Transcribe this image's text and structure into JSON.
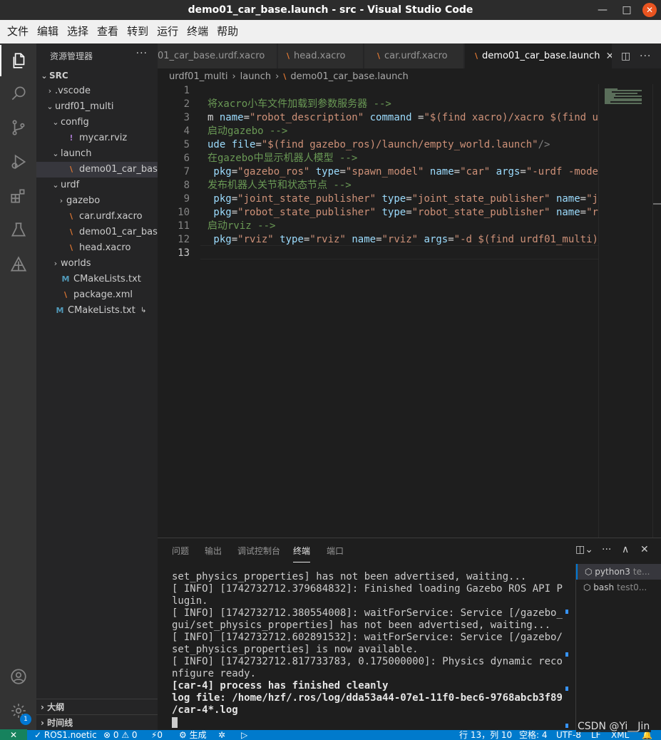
{
  "window": {
    "title": "demo01_car_base.launch - src - Visual Studio Code",
    "minimize_glyph": "—",
    "maximize_glyph": "□",
    "close_glyph": "✕"
  },
  "menu": [
    "文件",
    "编辑",
    "选择",
    "查看",
    "转到",
    "运行",
    "终端",
    "帮助"
  ],
  "activity_bar": {
    "icons": [
      "files-icon",
      "search-icon",
      "source-control-icon",
      "run-debug-icon",
      "extensions-icon",
      "testing-icon",
      "ros-icon"
    ],
    "bottom_icons": [
      "account-icon",
      "settings-gear-icon"
    ],
    "settings_badge": "1"
  },
  "sidebar": {
    "title": "资源管理器",
    "more": "···",
    "root": "SRC",
    "tree": [
      {
        "label": ".vscode",
        "indent": 1,
        "chevron": "›",
        "icon": ""
      },
      {
        "label": "urdf01_multi",
        "indent": 1,
        "chevron": "⌄",
        "icon": ""
      },
      {
        "label": "config",
        "indent": 2,
        "chevron": "⌄",
        "icon": ""
      },
      {
        "label": "mycar.rviz",
        "indent": 3,
        "chevron": "",
        "icon": "!"
      },
      {
        "label": "launch",
        "indent": 2,
        "chevron": "⌄",
        "icon": ""
      },
      {
        "label": "demo01_car_bas...",
        "indent": 3,
        "chevron": "",
        "icon": "rss",
        "selected": true
      },
      {
        "label": "urdf",
        "indent": 2,
        "chevron": "⌄",
        "icon": ""
      },
      {
        "label": "gazebo",
        "indent": 3,
        "chevron": "›",
        "icon": ""
      },
      {
        "label": "car.urdf.xacro",
        "indent": 3,
        "chevron": "",
        "icon": "rss"
      },
      {
        "label": "demo01_car_bas...",
        "indent": 3,
        "chevron": "",
        "icon": "rss"
      },
      {
        "label": "head.xacro",
        "indent": 3,
        "chevron": "",
        "icon": "rss"
      },
      {
        "label": "worlds",
        "indent": 2,
        "chevron": "›",
        "icon": ""
      },
      {
        "label": "CMakeLists.txt",
        "indent": 2,
        "chevron": "",
        "icon": "M"
      },
      {
        "label": "package.xml",
        "indent": 2,
        "chevron": "",
        "icon": "rss"
      },
      {
        "label": "CMakeLists.txt",
        "indent": 1,
        "chevron": "",
        "icon": "M",
        "link": "↳"
      }
    ],
    "sections": [
      "大纲",
      "时间线"
    ]
  },
  "tabs": [
    {
      "label": "01_car_base.urdf.xacro",
      "icon": ""
    },
    {
      "label": "head.xacro",
      "icon": "rss"
    },
    {
      "label": "car.urdf.xacro",
      "icon": "rss"
    },
    {
      "label": "demo01_car_base.launch",
      "icon": "rss",
      "active": true,
      "close": "✕"
    }
  ],
  "editor_actions": {
    "split": "◫",
    "more": "···"
  },
  "breadcrumb": [
    "urdf01_multi",
    "launch",
    "demo01_car_base.launch"
  ],
  "code": {
    "line_numbers": [
      "1",
      "2",
      "3",
      "4",
      "5",
      "6",
      "7",
      "8",
      "9",
      "10",
      "11",
      "12",
      "13"
    ],
    "current_line": 13,
    "lines": [
      [],
      [
        {
          "t": "将xacro小车文件加载到参数服务器 -->",
          "c": "com"
        }
      ],
      [
        {
          "t": "m ",
          "c": "txt"
        },
        {
          "t": "name",
          "c": "attr"
        },
        {
          "t": "=",
          "c": "txt"
        },
        {
          "t": "\"robot_description\"",
          "c": "str"
        },
        {
          "t": " ",
          "c": "txt"
        },
        {
          "t": "command",
          "c": "attr"
        },
        {
          "t": " =",
          "c": "txt"
        },
        {
          "t": "\"$(find xacro)/xacro $(find u",
          "c": "str"
        }
      ],
      [
        {
          "t": "启动gazebo -->",
          "c": "com"
        }
      ],
      [
        {
          "t": "ude ",
          "c": "attr"
        },
        {
          "t": "file",
          "c": "attr"
        },
        {
          "t": "=",
          "c": "txt"
        },
        {
          "t": "\"$(find gazebo_ros)/launch/empty_world.launch\"",
          "c": "str"
        },
        {
          "t": "/>",
          "c": "tag"
        }
      ],
      [
        {
          "t": "在gazebo中显示机器人模型 -->",
          "c": "com"
        }
      ],
      [
        {
          "t": " pkg",
          "c": "attr"
        },
        {
          "t": "=",
          "c": "txt"
        },
        {
          "t": "\"gazebo_ros\"",
          "c": "str"
        },
        {
          "t": " ",
          "c": "txt"
        },
        {
          "t": "type",
          "c": "attr"
        },
        {
          "t": "=",
          "c": "txt"
        },
        {
          "t": "\"spawn_model\"",
          "c": "str"
        },
        {
          "t": " ",
          "c": "txt"
        },
        {
          "t": "name",
          "c": "attr"
        },
        {
          "t": "=",
          "c": "txt"
        },
        {
          "t": "\"car\"",
          "c": "str"
        },
        {
          "t": " ",
          "c": "txt"
        },
        {
          "t": "args",
          "c": "attr"
        },
        {
          "t": "=",
          "c": "txt"
        },
        {
          "t": "\"-urdf -mode",
          "c": "str"
        }
      ],
      [
        {
          "t": "发布机器人关节和状态节点 -->",
          "c": "com"
        }
      ],
      [
        {
          "t": " pkg",
          "c": "attr"
        },
        {
          "t": "=",
          "c": "txt"
        },
        {
          "t": "\"joint_state_publisher\"",
          "c": "str"
        },
        {
          "t": " ",
          "c": "txt"
        },
        {
          "t": "type",
          "c": "attr"
        },
        {
          "t": "=",
          "c": "txt"
        },
        {
          "t": "\"joint_state_publisher\"",
          "c": "str"
        },
        {
          "t": " ",
          "c": "txt"
        },
        {
          "t": "name",
          "c": "attr"
        },
        {
          "t": "=",
          "c": "txt"
        },
        {
          "t": "\"j",
          "c": "str"
        }
      ],
      [
        {
          "t": " pkg",
          "c": "attr"
        },
        {
          "t": "=",
          "c": "txt"
        },
        {
          "t": "\"robot_state_publisher\"",
          "c": "str"
        },
        {
          "t": " ",
          "c": "txt"
        },
        {
          "t": "type",
          "c": "attr"
        },
        {
          "t": "=",
          "c": "txt"
        },
        {
          "t": "\"robot_state_publisher\"",
          "c": "str"
        },
        {
          "t": " ",
          "c": "txt"
        },
        {
          "t": "name",
          "c": "attr"
        },
        {
          "t": "=",
          "c": "txt"
        },
        {
          "t": "\"r",
          "c": "str"
        }
      ],
      [
        {
          "t": "启动rviz -->",
          "c": "com"
        }
      ],
      [
        {
          "t": " pkg",
          "c": "attr"
        },
        {
          "t": "=",
          "c": "txt"
        },
        {
          "t": "\"rviz\"",
          "c": "str"
        },
        {
          "t": " ",
          "c": "txt"
        },
        {
          "t": "type",
          "c": "attr"
        },
        {
          "t": "=",
          "c": "txt"
        },
        {
          "t": "\"rviz\"",
          "c": "str"
        },
        {
          "t": " ",
          "c": "txt"
        },
        {
          "t": "name",
          "c": "attr"
        },
        {
          "t": "=",
          "c": "txt"
        },
        {
          "t": "\"rviz\"",
          "c": "str"
        },
        {
          "t": " ",
          "c": "txt"
        },
        {
          "t": "args",
          "c": "attr"
        },
        {
          "t": "=",
          "c": "txt"
        },
        {
          "t": "\"-d $(find urdf01_multi)",
          "c": "str"
        }
      ],
      []
    ]
  },
  "panel": {
    "tabs": [
      "问题",
      "输出",
      "调试控制台",
      "终端",
      "端口"
    ],
    "active_tab": "终端",
    "actions": {
      "layout": "◫⌄",
      "more": "···",
      "maximize": "∧",
      "close": "✕"
    },
    "terminal_lines": [
      {
        "t": "set_physics_properties] has not been advertised, waiting...",
        "bold": false
      },
      {
        "t": "[ INFO] [1742732712.379684832]: Finished loading Gazebo ROS API P",
        "bold": false
      },
      {
        "t": "lugin.",
        "bold": false
      },
      {
        "t": "[ INFO] [1742732712.380554008]: waitForService: Service [/gazebo_",
        "bold": false
      },
      {
        "t": "gui/set_physics_properties] has not been advertised, waiting...",
        "bold": false
      },
      {
        "t": "[ INFO] [1742732712.602891532]: waitForService: Service [/gazebo/",
        "bold": false
      },
      {
        "t": "set_physics_properties] is now available.",
        "bold": false
      },
      {
        "t": "[ INFO] [1742732712.817733783, 0.175000000]: Physics dynamic reco",
        "bold": false
      },
      {
        "t": "nfigure ready.",
        "bold": false
      },
      {
        "t": "[car-4] process has finished cleanly",
        "bold": true
      },
      {
        "t": "log file: /home/hzf/.ros/log/dda53a44-07e1-11f0-bec6-9768abcb3f89",
        "bold": true
      },
      {
        "t": "/car-4*.log",
        "bold": true
      }
    ],
    "terminals": [
      {
        "name": "python3",
        "sub": "te...",
        "active": true
      },
      {
        "name": "bash",
        "sub": "test0...",
        "active": false
      }
    ]
  },
  "status": {
    "remote": "✕",
    "ros": "✓ ROS1.noetic",
    "problems": "⊗ 0 ⚠ 0",
    "ports": "⚡0",
    "build": "⚙ 生成",
    "debug": "✲",
    "run": "▷",
    "position": "行 13，列 10",
    "spaces": "空格: 4",
    "encoding": "UTF-8",
    "eol": "LF",
    "language": "XML",
    "notifications": "🔔"
  },
  "watermark": "CSDN @Yi__Jin"
}
